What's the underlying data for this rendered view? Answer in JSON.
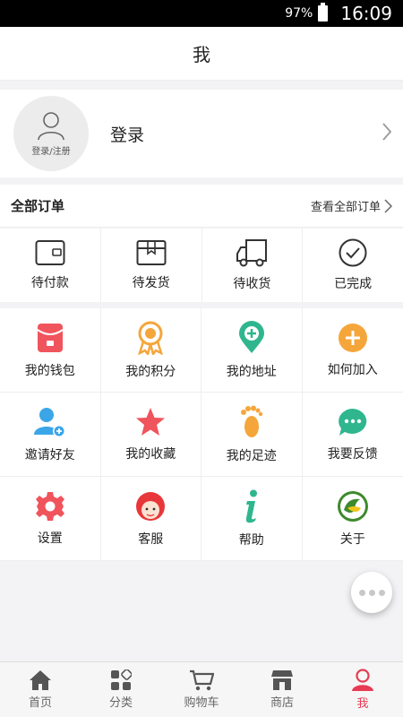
{
  "status": {
    "battery": "97%",
    "time": "16:09"
  },
  "header": {
    "title": "我"
  },
  "profile": {
    "avatar_caption": "登录/注册",
    "login_label": "登录"
  },
  "orders": {
    "title": "全部订单",
    "view_all": "查看全部订单",
    "items": [
      {
        "label": "待付款",
        "icon": "wallet-icon"
      },
      {
        "label": "待发货",
        "icon": "package-icon"
      },
      {
        "label": "待收货",
        "icon": "truck-icon"
      },
      {
        "label": "已完成",
        "icon": "check-circle-icon"
      }
    ]
  },
  "menu": {
    "items": [
      {
        "label": "我的钱包",
        "icon": "red-envelope-icon",
        "color": "#f0545c"
      },
      {
        "label": "我的积分",
        "icon": "medal-icon",
        "color": "#f5a63b"
      },
      {
        "label": "我的地址",
        "icon": "location-pin-icon",
        "color": "#2fb68e"
      },
      {
        "label": "如何加入",
        "icon": "plus-circle-icon",
        "color": "#f5a63b"
      },
      {
        "label": "邀请好友",
        "icon": "add-friend-icon",
        "color": "#3aa6e8"
      },
      {
        "label": "我的收藏",
        "icon": "star-icon",
        "color": "#f0545c"
      },
      {
        "label": "我的足迹",
        "icon": "footprint-icon",
        "color": "#f5a63b"
      },
      {
        "label": "我要反馈",
        "icon": "chat-bubble-icon",
        "color": "#2fb68e"
      },
      {
        "label": "设置",
        "icon": "gear-icon",
        "color": "#f0545c"
      },
      {
        "label": "客服",
        "icon": "customer-service-icon",
        "color": "#e8373a"
      },
      {
        "label": "帮助",
        "icon": "info-icon",
        "color": "#2fb68e"
      },
      {
        "label": "关于",
        "icon": "logo-icon",
        "color": "#3d8a2e"
      }
    ]
  },
  "tabbar": {
    "items": [
      {
        "label": "首页",
        "icon": "home-icon"
      },
      {
        "label": "分类",
        "icon": "category-icon"
      },
      {
        "label": "购物车",
        "icon": "cart-icon"
      },
      {
        "label": "商店",
        "icon": "store-icon"
      },
      {
        "label": "我",
        "icon": "user-icon",
        "active": true
      }
    ],
    "active_color": "#e63b53"
  }
}
